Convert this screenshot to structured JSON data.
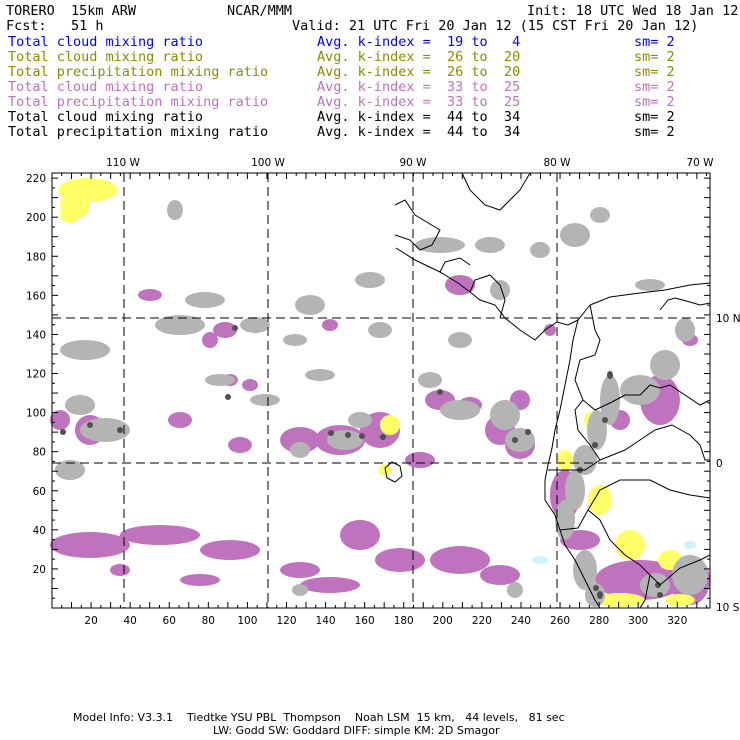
{
  "header": {
    "model": "TORERO  15km ARW",
    "org": "NCAR/MMM",
    "init": "Init: 18 UTC Wed 18 Jan 12",
    "fcst": "Fcst:   51 h",
    "valid": "Valid: 21 UTC Fri 20 Jan 12 (15 CST Fri 20 Jan 12)"
  },
  "legend": [
    {
      "field": "Total cloud mixing ratio",
      "range": "Avg. k-index =  19 to   4",
      "sm": "sm= 2",
      "color": "#0000ff"
    },
    {
      "field": "Total cloud mixing ratio",
      "range": "Avg. k-index =  26 to  20",
      "sm": "sm= 2",
      "color": "#8c8c00"
    },
    {
      "field": "Total precipitation mixing ratio",
      "range": "Avg. k-index =  26 to  20",
      "sm": "sm= 2",
      "color": "#8c8c00"
    },
    {
      "field": "Total cloud mixing ratio",
      "range": "Avg. k-index =  33 to  25",
      "sm": "sm= 2",
      "color": "#c070c0"
    },
    {
      "field": "Total precipitation mixing ratio",
      "range": "Avg. k-index =  33 to  25",
      "sm": "sm= 2",
      "color": "#c070c0"
    },
    {
      "field": "Total cloud mixing ratio",
      "range": "Avg. k-index =  44 to  34",
      "sm": "sm= 2",
      "color": "#000000"
    },
    {
      "field": "Total precipitation mixing ratio",
      "range": "Avg. k-index =  44 to  34",
      "sm": "sm= 2",
      "color": "#000000"
    }
  ],
  "axes": {
    "x_ticks": [
      "20",
      "40",
      "60",
      "80",
      "100",
      "120",
      "140",
      "160",
      "180",
      "200",
      "220",
      "240",
      "260",
      "280",
      "300",
      "320"
    ],
    "y_ticks": [
      "20",
      "40",
      "60",
      "80",
      "100",
      "120",
      "140",
      "160",
      "180",
      "200",
      "220"
    ],
    "lon_labels": [
      "110 W",
      "100 W",
      "90 W",
      "80 W",
      "70 W"
    ],
    "lat_labels": [
      "10 N",
      "0",
      "10 S"
    ]
  },
  "footer": {
    "line1": "Model Info: V3.3.1    Tiedtke YSU PBL  Thompson    Noah LSM  15 km,   44 levels,   81 sec",
    "line2": "LW: Godd SW: Goddard DIFF: simple KM: 2D Smagor"
  },
  "colors": {
    "gray": "#b4b4b4",
    "purple": "#bf73bf",
    "yellow": "#ffff66",
    "dark": "#505050",
    "cyan": "#cdf3ff"
  }
}
